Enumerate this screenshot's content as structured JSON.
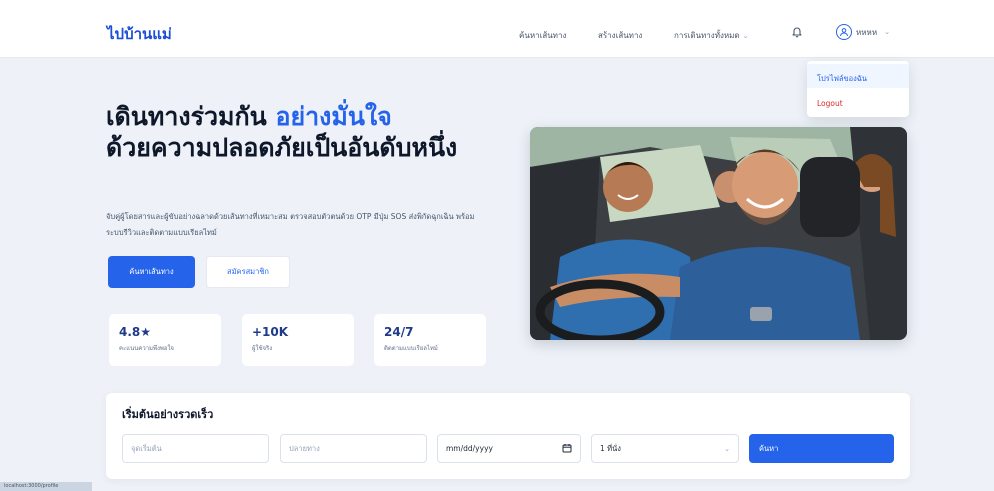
{
  "navbar": {
    "brand": "ไปบ้านแม่",
    "links": {
      "find_trip": "ค้นหาเส้นทาง",
      "create_trip": "สร้างเส้นทาง",
      "manage_trips": "การเดินทางทั้งหมด"
    },
    "user_name": "หหหห"
  },
  "user_dropdown": {
    "profile": "โปรไฟล์ของฉัน",
    "logout": "Logout"
  },
  "hero": {
    "title_line1": "เดินทางร่วมกัน ",
    "title_accent": "อย่างมั่นใจ",
    "title_line2": "ด้วยความปลอดภัยเป็นอันดับหนึ่ง",
    "description": "จับคู่ผู้โดยสารและผู้ขับอย่างฉลาดด้วยเส้นทางที่เหมาะสม ตรวจสอบตัวตนด้วย OTP มีปุ่ม SOS ส่งพิกัดฉุกเฉิน พร้อมระบบรีวิวและติดตามแบบเรียลไทม์",
    "primary_button": "ค้นหาเส้นทาง",
    "secondary_button": "สมัครสมาชิก"
  },
  "stats": [
    {
      "value": "4.8★",
      "label": "คะแนนความพึงพอใจ"
    },
    {
      "value": "+10K",
      "label": "ผู้ใช้จริง"
    },
    {
      "value": "24/7",
      "label": "ติดตามแบบเรียลไทม์"
    }
  ],
  "quick_search": {
    "title": "เริ่มต้นอย่างรวดเร็ว",
    "from_placeholder": "จุดเริ่มต้น",
    "to_placeholder": "ปลายทาง",
    "date_value": "mm/dd/yyyy",
    "seats_value": "1 ที่นั่ง",
    "search_button": "ค้นหา"
  },
  "status_bar": "localhost:3000/profile",
  "colors": {
    "accent": "#2563eb",
    "danger": "#dc2626",
    "background": "#eef2f8"
  }
}
